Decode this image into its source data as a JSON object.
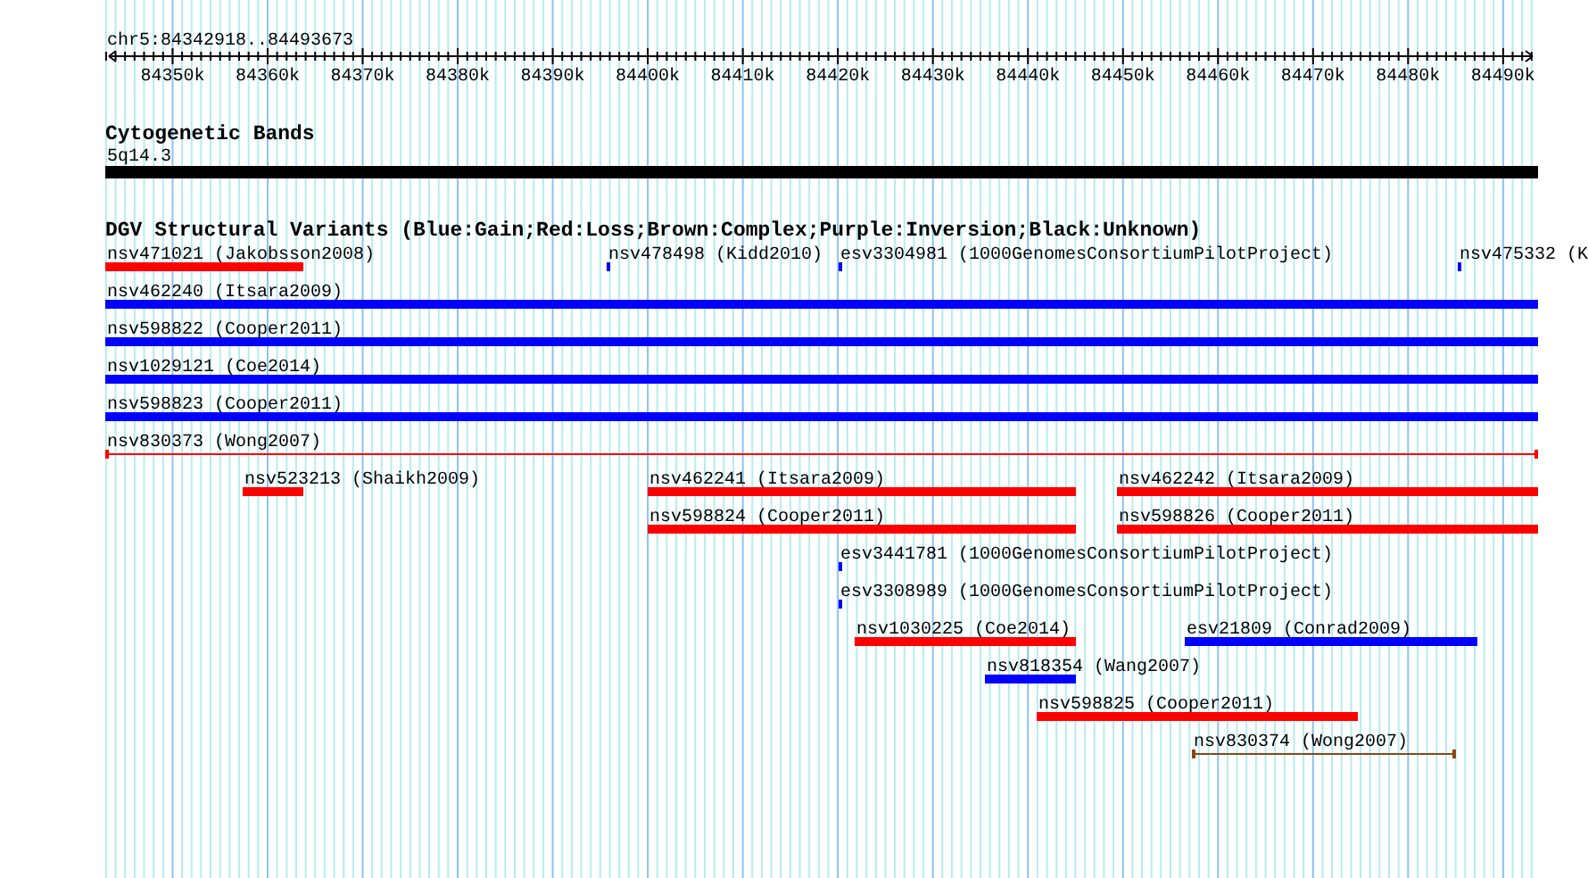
{
  "position": "chr5:84342918..84493673",
  "ruler": {
    "ticks": [
      "84350k",
      "84360k",
      "84370k",
      "84380k",
      "84390k",
      "84400k",
      "84410k",
      "84420k",
      "84430k",
      "84440k",
      "84450k",
      "84460k",
      "84470k",
      "84480k",
      "84490k"
    ]
  },
  "cytogenetic_bands": {
    "title": "Cytogenetic Bands",
    "band": {
      "label": "5q14.3",
      "color": "#000000"
    }
  },
  "structural_variants": {
    "title": "DGV Structural Variants (Blue:Gain;Red:Loss;Brown:Complex;Purple:Inversion;Black:Unknown)",
    "features": [
      {
        "label": "nsv471021 (Jakobsson2008)",
        "color": "#ff0000",
        "kind": "bar"
      },
      {
        "label": "nsv478498 (Kidd2010)",
        "color": "#0000ff",
        "kind": "bar"
      },
      {
        "label": "esv3304981 (1000GenomesConsortiumPilotProject)",
        "color": "#0000ff",
        "kind": "bar"
      },
      {
        "label": "nsv475332 (K",
        "color": "#0000ff",
        "kind": "bar"
      },
      {
        "label": "nsv462240 (Itsara2009)",
        "color": "#0000ff",
        "kind": "bar"
      },
      {
        "label": "nsv598822 (Cooper2011)",
        "color": "#0000ff",
        "kind": "bar"
      },
      {
        "label": "nsv1029121 (Coe2014)",
        "color": "#0000ff",
        "kind": "bar"
      },
      {
        "label": "nsv598823 (Cooper2011)",
        "color": "#0000ff",
        "kind": "bar"
      },
      {
        "label": "nsv830373 (Wong2007)",
        "color": "#ff0000",
        "kind": "line"
      },
      {
        "label": "nsv523213 (Shaikh2009)",
        "color": "#ff0000",
        "kind": "bar"
      },
      {
        "label": "nsv462241 (Itsara2009)",
        "color": "#ff0000",
        "kind": "bar"
      },
      {
        "label": "nsv462242 (Itsara2009)",
        "color": "#ff0000",
        "kind": "bar"
      },
      {
        "label": "nsv598824 (Cooper2011)",
        "color": "#ff0000",
        "kind": "bar"
      },
      {
        "label": "nsv598826 (Cooper2011)",
        "color": "#ff0000",
        "kind": "bar"
      },
      {
        "label": "esv3441781 (1000GenomesConsortiumPilotProject)",
        "color": "#0000ff",
        "kind": "bar"
      },
      {
        "label": "esv3308989 (1000GenomesConsortiumPilotProject)",
        "color": "#0000ff",
        "kind": "bar"
      },
      {
        "label": "nsv1030225 (Coe2014)",
        "color": "#ff0000",
        "kind": "bar"
      },
      {
        "label": "esv21809 (Conrad2009)",
        "color": "#0000ff",
        "kind": "bar"
      },
      {
        "label": "nsv818354 (Wang2007)",
        "color": "#0000ff",
        "kind": "bar"
      },
      {
        "label": "nsv598825 (Cooper2011)",
        "color": "#ff0000",
        "kind": "bar"
      },
      {
        "label": "nsv830374 (Wong2007)",
        "color": "#8b4513",
        "kind": "line"
      }
    ]
  }
}
